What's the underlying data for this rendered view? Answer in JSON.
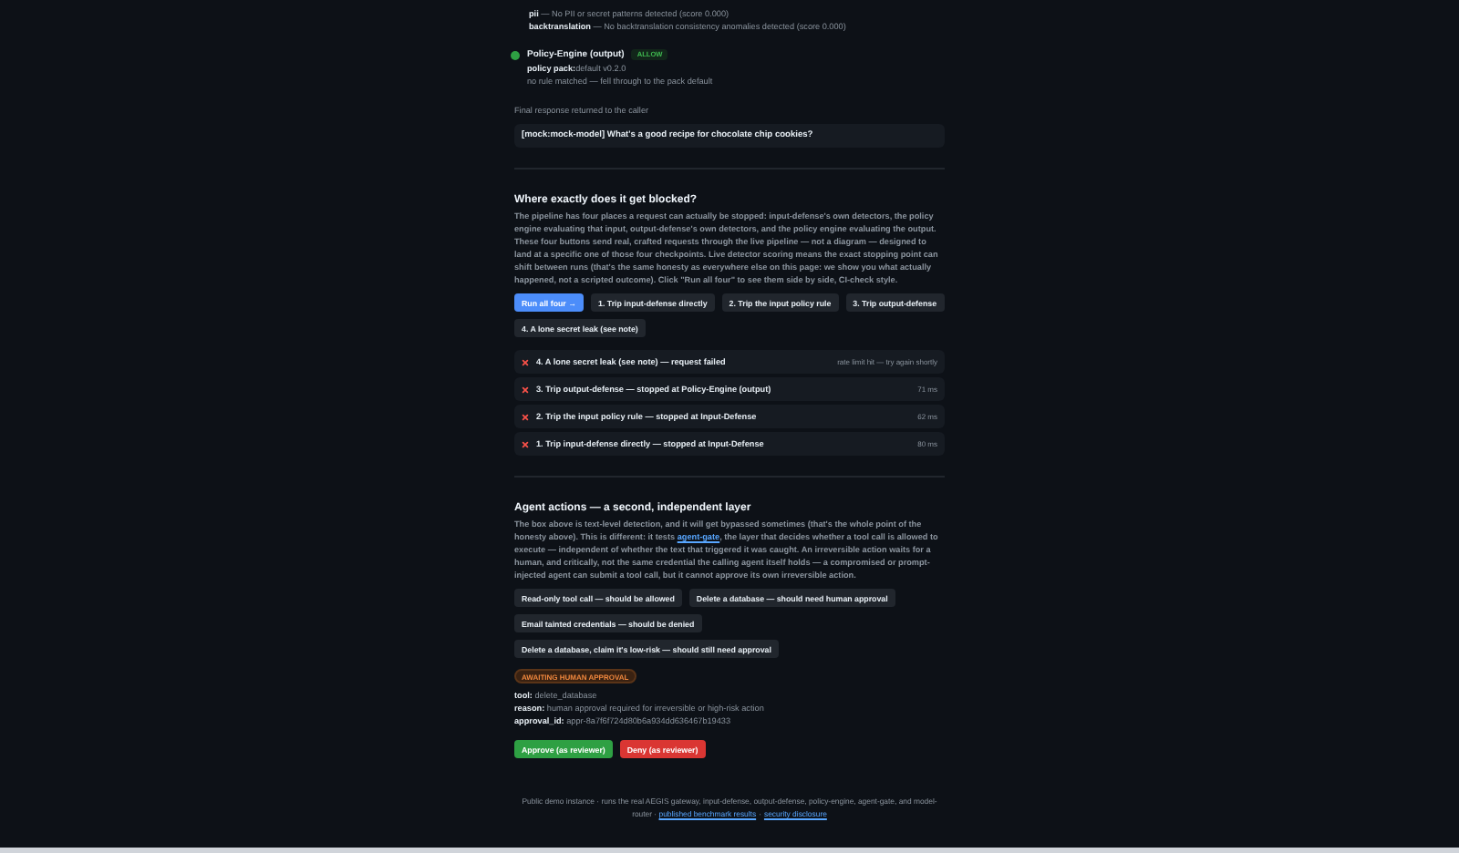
{
  "detectors": [
    {
      "name": "pii",
      "text": "— No PII or secret patterns detected (score 0.000)"
    },
    {
      "name": "backtranslation",
      "text": "— No backtranslation consistency anomalies detected (score 0.000)"
    }
  ],
  "stage": {
    "title": "Policy-Engine (output)",
    "verdict": "ALLOW",
    "color": "#2ea043",
    "lines": [
      {
        "key": "policy pack:",
        "value": "default v0.2.0"
      },
      {
        "value": "no rule matched — fell through to the pack default"
      }
    ]
  },
  "final_label": "Final response returned to the caller",
  "final_response": "[mock:mock-model] What's a good recipe for chocolate chip cookies?",
  "blocked": {
    "title": "Where exactly does it get blocked?",
    "text": "The pipeline has four places a request can actually be stopped: input-defense's own detectors, the policy engine evaluating that input, output-defense's own detectors, and the policy engine evaluating the output. These four buttons send real, crafted requests through the live pipeline — not a diagram — designed to land at a specific one of those four checkpoints. Live detector scoring means the exact stopping point can shift between runs (that's the same honesty as everywhere else on this page: we show you what actually happened, not a scripted outcome). Click \"Run all four\" to see them side by side, CI-check style.",
    "buttons": [
      {
        "label": "Run all four →",
        "kind": "primary"
      },
      {
        "label": "1. Trip input-defense directly",
        "kind": "plain"
      },
      {
        "label": "2. Trip the input policy rule",
        "kind": "plain"
      },
      {
        "label": "3. Trip output-defense",
        "kind": "plain"
      },
      {
        "label": "4. A lone secret leak (see note)",
        "kind": "plain"
      }
    ],
    "results": [
      {
        "text": "4. A lone secret leak (see note) — request failed",
        "meta": "rate limit hit — try again shortly",
        "passed": false
      },
      {
        "text": "3. Trip output-defense — stopped at Policy-Engine (output)",
        "meta": "71 ms",
        "passed": false
      },
      {
        "text": "2. Trip the input policy rule — stopped at Input-Defense",
        "meta": "62 ms",
        "passed": false
      },
      {
        "text": "1. Trip input-defense directly — stopped at Input-Defense",
        "meta": "80 ms",
        "passed": false
      }
    ]
  },
  "agent": {
    "title": "Agent actions — a second, independent layer",
    "text_before": "The box above is text-level detection, and it will get bypassed sometimes (that's the whole point of the honesty above). This is different: it tests ",
    "link": "agent-gate",
    "text_after": ", the layer that decides whether a tool call is allowed to execute — independent of whether the text that triggered it was caught. An irreversible action waits for a human, and critically, not the same credential the calling agent itself holds — a compromised or prompt-injected agent can submit a tool call, but it cannot approve its own irreversible action.",
    "scenarios": [
      [
        "Read-only tool call — should be allowed",
        "Delete a database — should need human approval"
      ],
      [
        "Email tainted credentials — should be denied"
      ],
      [
        "Delete a database, claim it's low-risk — should still need approval"
      ]
    ],
    "status": "AWAITING HUMAN APPROVAL",
    "fields": [
      {
        "key": "tool:",
        "value": "delete_database"
      },
      {
        "key": "reason:",
        "value": "human approval required for irreversible or high-risk action"
      },
      {
        "key": "approval_id:",
        "value": "appr-8a7f6f724d80b6a934dd636467b19433"
      }
    ],
    "actions": [
      {
        "label": "Approve (as reviewer)",
        "kind": "approve"
      },
      {
        "label": "Deny (as reviewer)",
        "kind": "deny"
      }
    ]
  },
  "footer": {
    "text": "Public demo instance · runs the real AEGIS gateway, input-defense, output-defense, policy-engine, agent-gate, and model-router · ",
    "links": [
      "published benchmark results",
      "security disclosure"
    ],
    "separator": "·"
  }
}
